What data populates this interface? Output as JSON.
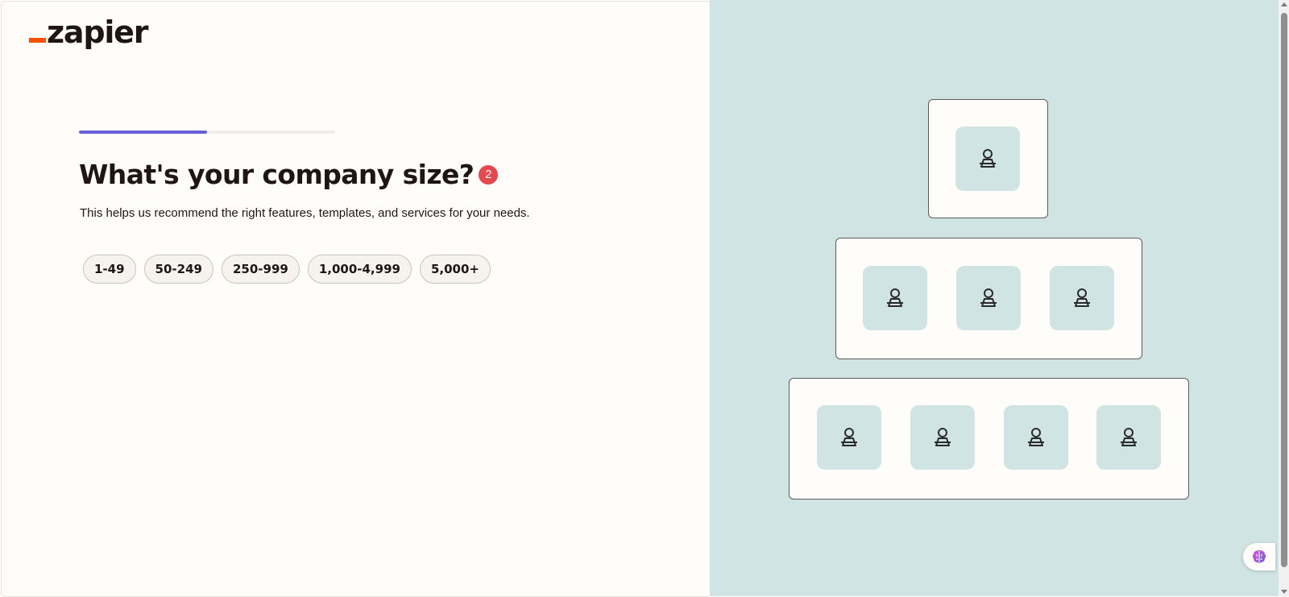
{
  "brand": {
    "logo_text": "zapier",
    "accent_color": "#ff4f00"
  },
  "progress": {
    "fraction": 0.5,
    "color": "#6a5fdb"
  },
  "question": {
    "title": "What's your company size?",
    "badge_count": "2",
    "subtitle": "This helps us recommend the right features, templates, and services for your needs."
  },
  "options": [
    "1-49",
    "50-249",
    "250-999",
    "1,000-4,999",
    "5,000+"
  ],
  "illustration": {
    "tiers": [
      {
        "people": 1
      },
      {
        "people": 3
      },
      {
        "people": 4
      }
    ],
    "icon": "person-at-desk-icon",
    "background_color": "#cfe4e3"
  },
  "assistant": {
    "icon": "brain-icon"
  }
}
